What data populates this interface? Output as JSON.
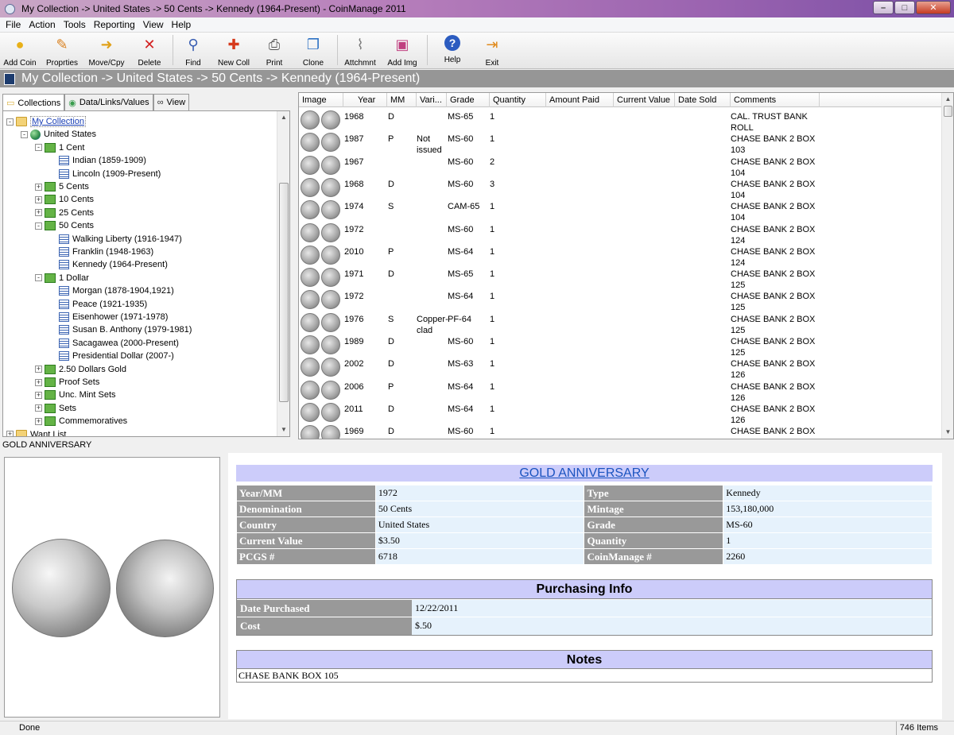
{
  "window": {
    "title": "My Collection -> United States -> 50 Cents -> Kennedy (1964-Present) - CoinManage 2011"
  },
  "menu": [
    "File",
    "Action",
    "Tools",
    "Reporting",
    "View",
    "Help"
  ],
  "toolbar": [
    {
      "label": "Add Coin",
      "icon": "add-coin-icon"
    },
    {
      "label": "Proprties",
      "icon": "properties-icon"
    },
    {
      "label": "Move/Cpy",
      "icon": "move-copy-icon"
    },
    {
      "label": "Delete",
      "icon": "delete-icon"
    },
    {
      "label": "Find",
      "icon": "find-icon"
    },
    {
      "label": "New Coll",
      "icon": "new-collection-icon"
    },
    {
      "label": "Print",
      "icon": "print-icon"
    },
    {
      "label": "Clone",
      "icon": "clone-icon"
    },
    {
      "label": "Attchmnt",
      "icon": "attachment-icon"
    },
    {
      "label": "Add Img",
      "icon": "add-image-icon"
    },
    {
      "label": "Help",
      "icon": "help-icon"
    },
    {
      "label": "Exit",
      "icon": "exit-icon"
    }
  ],
  "path": "My Collection -> United States -> 50 Cents -> Kennedy (1964-Present)",
  "tabs": [
    "Collections",
    "Data/Links/Values",
    "View"
  ],
  "tree": [
    {
      "label": "My Collection",
      "level": 0,
      "type": "folder",
      "exp": "-",
      "selected": true
    },
    {
      "label": "United States",
      "level": 1,
      "type": "globe",
      "exp": "-"
    },
    {
      "label": "1 Cent",
      "level": 2,
      "type": "money",
      "exp": "-"
    },
    {
      "label": "Indian (1859-1909)",
      "level": 3,
      "type": "list",
      "exp": ""
    },
    {
      "label": "Lincoln (1909-Present)",
      "level": 3,
      "type": "list",
      "exp": ""
    },
    {
      "label": "5 Cents",
      "level": 2,
      "type": "money",
      "exp": "+"
    },
    {
      "label": "10 Cents",
      "level": 2,
      "type": "money",
      "exp": "+"
    },
    {
      "label": "25 Cents",
      "level": 2,
      "type": "money",
      "exp": "+"
    },
    {
      "label": "50 Cents",
      "level": 2,
      "type": "money",
      "exp": "-"
    },
    {
      "label": "Walking Liberty (1916-1947)",
      "level": 3,
      "type": "list",
      "exp": ""
    },
    {
      "label": "Franklin (1948-1963)",
      "level": 3,
      "type": "list",
      "exp": ""
    },
    {
      "label": "Kennedy (1964-Present)",
      "level": 3,
      "type": "list",
      "exp": ""
    },
    {
      "label": "1 Dollar",
      "level": 2,
      "type": "money",
      "exp": "-"
    },
    {
      "label": "Morgan (1878-1904,1921)",
      "level": 3,
      "type": "list",
      "exp": ""
    },
    {
      "label": "Peace (1921-1935)",
      "level": 3,
      "type": "list",
      "exp": ""
    },
    {
      "label": "Eisenhower (1971-1978)",
      "level": 3,
      "type": "list",
      "exp": ""
    },
    {
      "label": "Susan B. Anthony (1979-1981)",
      "level": 3,
      "type": "list",
      "exp": ""
    },
    {
      "label": "Sacagawea (2000-Present)",
      "level": 3,
      "type": "list",
      "exp": ""
    },
    {
      "label": "Presidential Dollar (2007-)",
      "level": 3,
      "type": "list",
      "exp": ""
    },
    {
      "label": "2.50 Dollars Gold",
      "level": 2,
      "type": "money",
      "exp": "+"
    },
    {
      "label": "Proof Sets",
      "level": 2,
      "type": "money",
      "exp": "+"
    },
    {
      "label": "Unc. Mint Sets",
      "level": 2,
      "type": "money",
      "exp": "+"
    },
    {
      "label": "Sets",
      "level": 2,
      "type": "money",
      "exp": "+"
    },
    {
      "label": "Commemoratives",
      "level": 2,
      "type": "money",
      "exp": "+"
    },
    {
      "label": "Want List",
      "level": 0,
      "type": "folder",
      "exp": "+"
    }
  ],
  "grid": {
    "columns": [
      "Image",
      "Year",
      "MM",
      "Vari...",
      "Grade",
      "Quantity",
      "Amount Paid",
      "Current Value",
      "Date Sold",
      "Comments"
    ],
    "rows": [
      [
        "1968",
        "D",
        "",
        "MS-65",
        "1",
        "CAL. TRUST BANK",
        "ROLL"
      ],
      [
        "1987",
        "P",
        "Not issued",
        "MS-60",
        "1",
        "CHASE BANK 2 BOX",
        "103"
      ],
      [
        "1967",
        "",
        "",
        "MS-60",
        "2",
        "CHASE BANK 2 BOX",
        "104"
      ],
      [
        "1968",
        "D",
        "",
        "MS-60",
        "3",
        "CHASE BANK 2 BOX",
        "104"
      ],
      [
        "1974",
        "S",
        "",
        "CAM-65",
        "1",
        "CHASE BANK 2 BOX",
        "104"
      ],
      [
        "1972",
        "",
        "",
        "MS-60",
        "1",
        "CHASE BANK 2 BOX",
        "124"
      ],
      [
        "2010",
        "P",
        "",
        "MS-64",
        "1",
        "CHASE BANK 2 BOX",
        "124"
      ],
      [
        "1971",
        "D",
        "",
        "MS-65",
        "1",
        "CHASE BANK 2 BOX",
        "125"
      ],
      [
        "1972",
        "",
        "",
        "MS-64",
        "1",
        "CHASE BANK 2 BOX",
        "125"
      ],
      [
        "1976",
        "S",
        "Copper-clad",
        "PF-64",
        "1",
        "CHASE BANK 2 BOX",
        "125"
      ],
      [
        "1989",
        "D",
        "",
        "MS-60",
        "1",
        "CHASE BANK 2 BOX",
        "125"
      ],
      [
        "2002",
        "D",
        "",
        "MS-63",
        "1",
        "CHASE BANK 2 BOX",
        "126"
      ],
      [
        "2006",
        "P",
        "",
        "MS-64",
        "1",
        "CHASE BANK 2 BOX",
        "126"
      ],
      [
        "2011",
        "D",
        "",
        "MS-64",
        "1",
        "CHASE BANK 2 BOX",
        "126"
      ],
      [
        "1969",
        "D",
        "",
        "MS-60",
        "1",
        "CHASE BANK 2 BOX",
        ""
      ]
    ]
  },
  "selected_label": "GOLD ANNIVERSARY",
  "detail": {
    "title": "GOLD ANNIVERSARY",
    "fields": [
      [
        "Year/MM",
        "1972",
        "Type",
        "Kennedy"
      ],
      [
        "Denomination",
        "50 Cents",
        "Mintage",
        "153,180,000"
      ],
      [
        "Country",
        "United States",
        "Grade",
        "MS-60"
      ],
      [
        "Current Value",
        "$3.50",
        "Quantity",
        "1"
      ],
      [
        "PCGS #",
        "6718",
        "CoinManage #",
        "2260"
      ]
    ],
    "purchasing_title": "Purchasing Info",
    "purchasing": [
      [
        "Date Purchased",
        "12/22/2011"
      ],
      [
        "Cost",
        "$.50"
      ]
    ],
    "notes_title": "Notes",
    "notes": "CHASE BANK BOX 105"
  },
  "status": {
    "left": "Done",
    "right": "746 Items"
  }
}
